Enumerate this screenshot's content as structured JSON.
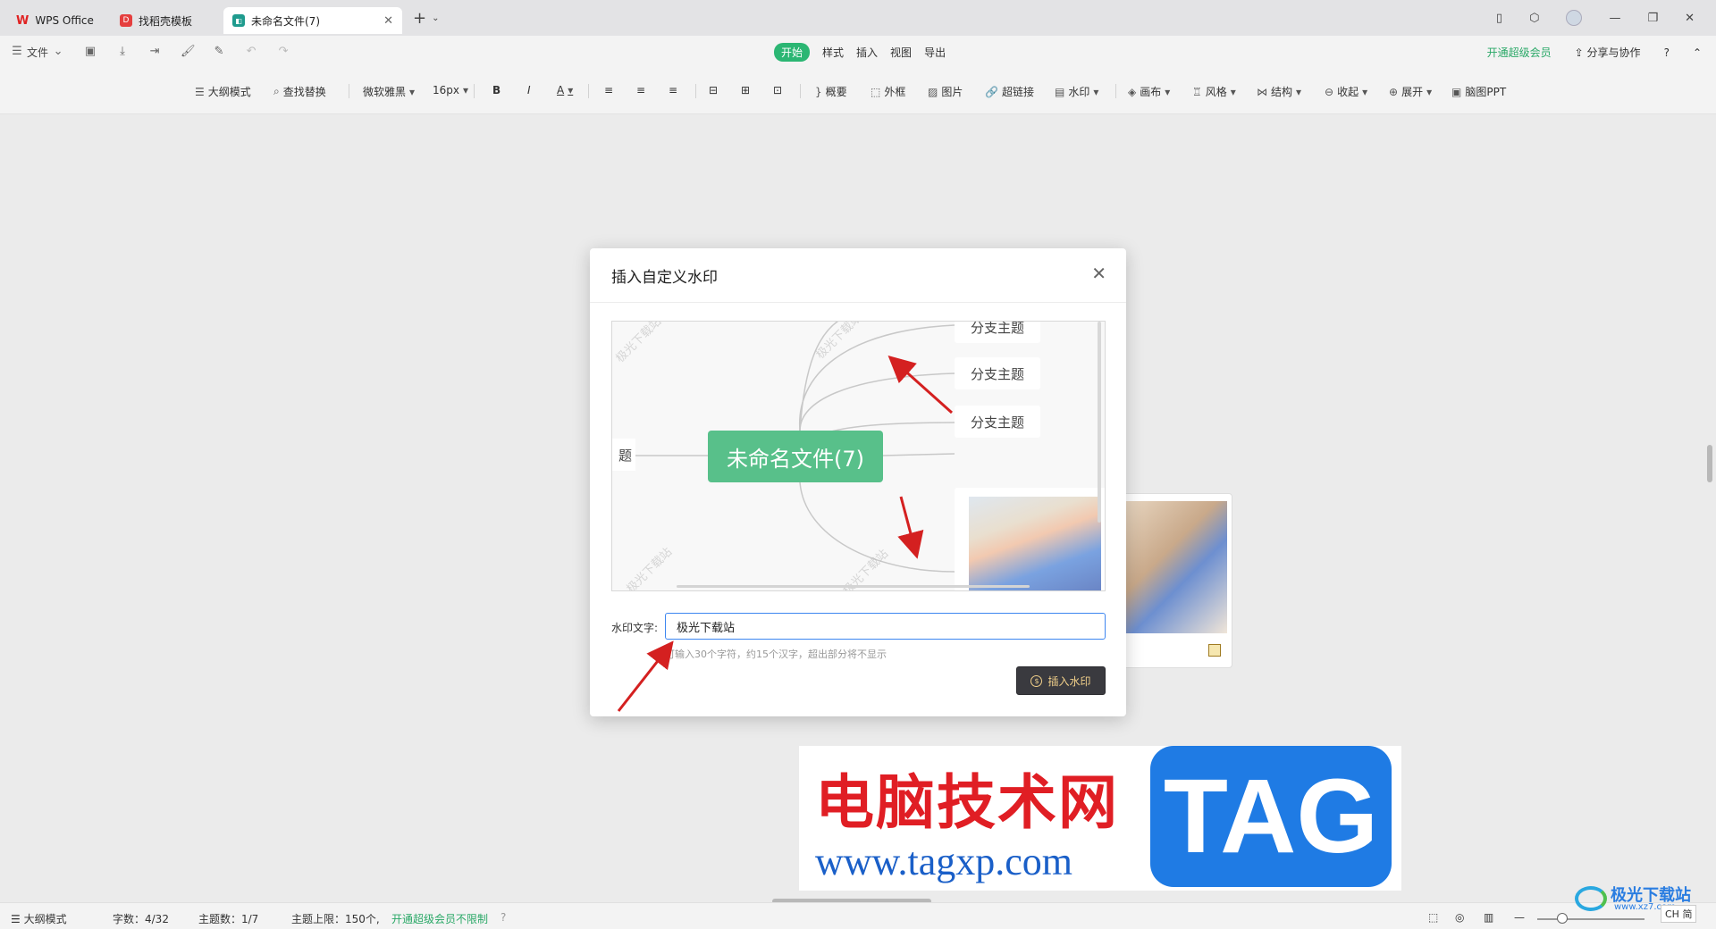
{
  "tabs": [
    {
      "label": "WPS Office"
    },
    {
      "label": "找稻壳模板"
    },
    {
      "label": "未命名文件(7)"
    }
  ],
  "menu": {
    "file": "文件",
    "items": [
      "开始",
      "样式",
      "插入",
      "视图",
      "导出"
    ],
    "vip": "开通超级会员",
    "share": "分享与协作"
  },
  "toolbar": {
    "outline": "大纲模式",
    "find": "查找替换",
    "font": "微软雅黑",
    "size": "16px",
    "bold": "B",
    "italic": "I",
    "color": "A",
    "summary": "概要",
    "frame": "外框",
    "image": "图片",
    "link": "超链接",
    "watermark": "水印",
    "canvas": "画布",
    "style": "风格",
    "structure": "结构",
    "collapse": "收起",
    "expand": "展开",
    "ppt": "脑图PPT"
  },
  "dialog": {
    "title": "插入自定义水印",
    "preview": {
      "root": "未命名文件(7)",
      "branches": [
        "分支主题",
        "分支主题",
        "分支主题"
      ],
      "left_node": "题",
      "watermark_text": "极光下载站"
    },
    "label": "水印文字:",
    "input_value": "极光下载站",
    "hint": "可输入30个字符，约15个汉字，超出部分将不显示",
    "insert_button": "插入水印"
  },
  "banner": {
    "cn": "电脑技术网",
    "url": "www.tagxp.com",
    "tag": "TAG"
  },
  "status": {
    "outline": "大纲模式",
    "words": "字数：4/32",
    "topics": "主题数：1/7",
    "limit": "主题上限：150个,",
    "vip": "开通超级会员不限制",
    "ime": "CH 简"
  },
  "site_logo": {
    "name": "极光下载站",
    "url": "www.xz7.com"
  },
  "colors": {
    "accent_green": "#2bb673",
    "root_node": "#58c08a",
    "input_focus": "#3d86f0",
    "arrow": "#d42020"
  }
}
